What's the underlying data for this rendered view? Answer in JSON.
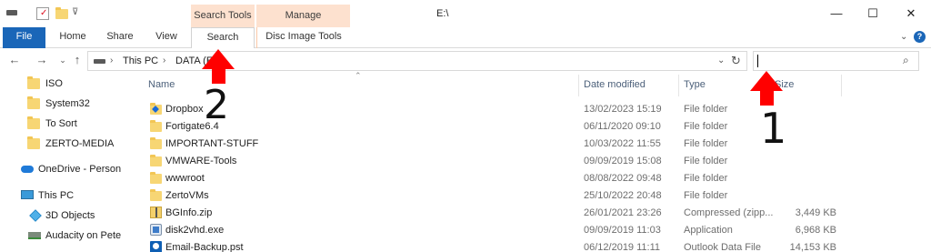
{
  "title_bar": {
    "path_title": "E:\\",
    "context_tabs": [
      {
        "label": "Search Tools"
      },
      {
        "label": "Manage"
      }
    ],
    "window_buttons": {
      "minimize": "—",
      "maximize": "☐",
      "close": "✕"
    }
  },
  "ribbon": {
    "tabs": [
      {
        "label": "File"
      },
      {
        "label": "Home"
      },
      {
        "label": "Share"
      },
      {
        "label": "View"
      },
      {
        "label": "Search"
      },
      {
        "label": "Disc Image Tools"
      }
    ]
  },
  "address": {
    "breadcrumbs": [
      "This PC",
      "DATA (E:)"
    ],
    "search_placeholder": ""
  },
  "nav_pane": {
    "items": [
      {
        "label": "ISO",
        "icon": "folder-icon"
      },
      {
        "label": "System32",
        "icon": "folder-icon"
      },
      {
        "label": "To Sort",
        "icon": "folder-icon"
      },
      {
        "label": "ZERTO-MEDIA",
        "icon": "folder-icon"
      },
      {
        "label": "OneDrive - Person",
        "icon": "cloud-icon"
      },
      {
        "label": "This PC",
        "icon": "computer-icon"
      },
      {
        "label": "3D Objects",
        "icon": "cube-icon"
      },
      {
        "label": "Audacity on Pete",
        "icon": "network-drive-icon"
      }
    ]
  },
  "file_list": {
    "columns": [
      "Name",
      "Date modified",
      "Type",
      "Size"
    ],
    "rows": [
      {
        "name": "Dropbox",
        "date": "13/02/2023 15:19",
        "type": "File folder",
        "size": "",
        "icon": "dropbox-folder-icon"
      },
      {
        "name": "Fortigate6.4",
        "date": "06/11/2020 09:10",
        "type": "File folder",
        "size": "",
        "icon": "folder-icon"
      },
      {
        "name": "IMPORTANT-STUFF",
        "date": "10/03/2022 11:55",
        "type": "File folder",
        "size": "",
        "icon": "folder-icon"
      },
      {
        "name": "VMWARE-Tools",
        "date": "09/09/2019 15:08",
        "type": "File folder",
        "size": "",
        "icon": "folder-icon"
      },
      {
        "name": "wwwroot",
        "date": "08/08/2022 09:48",
        "type": "File folder",
        "size": "",
        "icon": "folder-icon"
      },
      {
        "name": "ZertoVMs",
        "date": "25/10/2022 20:48",
        "type": "File folder",
        "size": "",
        "icon": "folder-icon"
      },
      {
        "name": "BGInfo.zip",
        "date": "26/01/2021 23:26",
        "type": "Compressed (zipp...",
        "size": "3,449 KB",
        "icon": "zip-icon"
      },
      {
        "name": "disk2vhd.exe",
        "date": "09/09/2019 11:03",
        "type": "Application",
        "size": "6,968 KB",
        "icon": "exe-icon"
      },
      {
        "name": "Email-Backup.pst",
        "date": "06/12/2019 11:11",
        "type": "Outlook Data File",
        "size": "14,153 KB",
        "icon": "pst-icon"
      }
    ]
  },
  "annotations": {
    "label_1": "1",
    "label_2": "2",
    "color": "#ff0000"
  }
}
